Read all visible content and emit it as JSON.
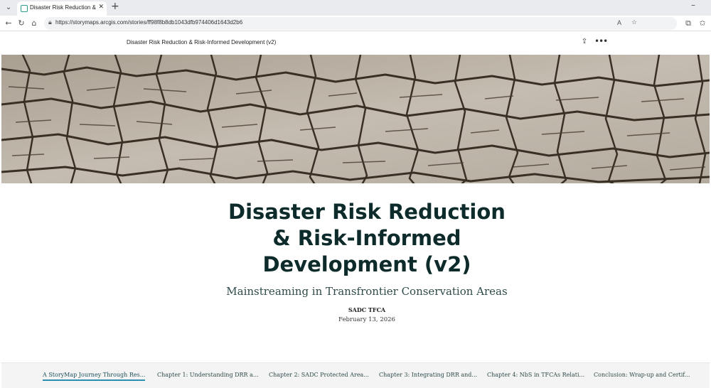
{
  "browser": {
    "tab_title": "Disaster Risk Reduction & Risk-Inf",
    "url": "https://storymaps.arcgis.com/stories/ff98f8b8db1043dfb974406d1643d2b6",
    "reader_mode_label": "A"
  },
  "story": {
    "header_title": "Disaster Risk Reduction & Risk-Informed Development (v2)",
    "title_line1": "Disaster Risk Reduction",
    "title_line2": "& Risk-Informed",
    "title_line3": "Development (v2)",
    "subtitle": "Mainstreaming in Transfrontier Conservation Areas",
    "author": "SADC TFCA",
    "date": "February 13, 2026"
  },
  "nav": {
    "items": [
      {
        "label": "A StoryMap Journey Through Res...",
        "active": true
      },
      {
        "label": "Chapter 1: Understanding DRR a..."
      },
      {
        "label": "Chapter 2: SADC Protected Area..."
      },
      {
        "label": "Chapter 3: Integrating DRR and..."
      },
      {
        "label": "Chapter 4: NbS in TFCAs Relati..."
      },
      {
        "label": "Conclusion: Wrap-up and Certif..."
      }
    ]
  },
  "icons": {
    "tab_list": "chevron-down-icon",
    "favicon": "storymaps-icon",
    "close": "close-icon",
    "new_tab": "plus-icon",
    "back": "back-arrow-icon",
    "refresh": "refresh-icon",
    "home": "home-icon",
    "lock": "lock-icon",
    "favorite": "star-icon",
    "extensions": "puzzle-icon",
    "favorites_bar": "favorites-icon",
    "share": "share-icon",
    "more": "more-icon"
  },
  "colors": {
    "title": "#0d2b2a",
    "nav_active_underline": "#2a8fb0",
    "hero_ground": "#b9b1a4",
    "hero_cracks": "#3a2f25"
  }
}
